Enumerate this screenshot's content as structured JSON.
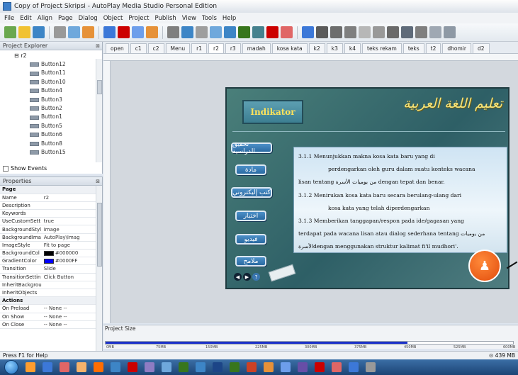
{
  "window": {
    "title": "Copy of Project Skripsi - AutoPlay Media Studio Personal Edition"
  },
  "menu": [
    "File",
    "Edit",
    "Align",
    "Page",
    "Dialog",
    "Object",
    "Project",
    "Publish",
    "View",
    "Tools",
    "Help"
  ],
  "toolbar": {
    "icons": [
      "wand-icon",
      "open-folder-icon",
      "save-icon",
      "cut-icon",
      "copy-icon",
      "paste-icon",
      "image-icon",
      "flash-icon",
      "video-icon",
      "web-icon",
      "button-icon",
      "label-icon",
      "paragraph-icon",
      "xbutton-icon",
      "slideshow-icon",
      "globe-icon",
      "plugin-icon",
      "audio-icon",
      "pdf-icon",
      "hotspot-icon",
      "input-icon",
      "checkbox-icon",
      "radio-icon",
      "combobox-icon",
      "listbox-icon",
      "tree-icon",
      "grid-icon",
      "progress-icon",
      "rectangle-icon",
      "line-icon"
    ],
    "colors": [
      "#6aa84f",
      "#f1c232",
      "#3d85c6",
      "#999999",
      "#6fa8dc",
      "#e69138",
      "#3c78d8",
      "#cc0000",
      "#6d9eeb",
      "#e69138",
      "#7f7f7f",
      "#3d85c6",
      "#9e9e9e",
      "#6fa8dc",
      "#3d85c6",
      "#38761d",
      "#45818e",
      "#cc0000",
      "#e06666",
      "#3c78d8",
      "#5b5b5b",
      "#6d6d6d",
      "#7f7f7f",
      "#b7b7b7",
      "#999999",
      "#6a6a6a",
      "#5f6b7a",
      "#7f7f7f",
      "#9fa8b3",
      "#8e99a5"
    ]
  },
  "explorer": {
    "title": "Project Explorer",
    "root": "r2",
    "items": [
      "Button12",
      "Button11",
      "Button10",
      "Button4",
      "Button3",
      "Button2",
      "Button1",
      "Button5",
      "Button6",
      "Button8",
      "Button15"
    ],
    "show_events_label": "Show Events"
  },
  "properties": {
    "title": "Properties",
    "section_page": "Page",
    "rows": [
      {
        "key": "Name",
        "value": "r2"
      },
      {
        "key": "Description",
        "value": ""
      },
      {
        "key": "Keywords",
        "value": ""
      },
      {
        "key": "UseCustomSett",
        "value": "true"
      },
      {
        "key": "BackgroundStyl",
        "value": "Image"
      },
      {
        "key": "BackgroundIma",
        "value": "AutoPlay\\Imag"
      },
      {
        "key": "ImageStyle",
        "value": "Fit to page"
      },
      {
        "key": "BackgroundCol",
        "value": "#000000",
        "swatch": "#000000"
      },
      {
        "key": "GradientColor",
        "value": "#0000FF",
        "swatch": "#0000FF"
      },
      {
        "key": "Transition",
        "value": "Slide"
      },
      {
        "key": "TransitionSettin",
        "value": "Click Button"
      },
      {
        "key": "InheritBackgrou",
        "value": ""
      },
      {
        "key": "InheritObjects",
        "value": ""
      }
    ],
    "section_actions": "Actions",
    "action_rows": [
      {
        "key": "On Preload",
        "value": "-- None --"
      },
      {
        "key": "On Show",
        "value": "-- None --"
      },
      {
        "key": "On Close",
        "value": "-- None --"
      }
    ]
  },
  "tabs": [
    "open",
    "c1",
    "c2",
    "Menu",
    "r1",
    "r2",
    "r3",
    "madah",
    "kosa kata",
    "k2",
    "k3",
    "k4",
    "teks rekam",
    "teks",
    "t2",
    "dhomir",
    "d2"
  ],
  "active_tab": "r2",
  "stage": {
    "title_box": "Indikator",
    "header_arabic": "تعليم اللغة العربية",
    "nav_buttons": [
      "تحقيق الدراسية",
      "مادة",
      "كتب إليكتروني",
      "اختبار",
      "فيديو",
      "ملامح"
    ],
    "content_lines": [
      "3.1.1      Menunjukkan   makna   kosa   kata   baru   yang   di",
      "perdengarkan oleh guru dalam suatu konteks        wacana",
      "lisan tentang من يوميات الأسرة dengan tepat        dan benar.",
      "3.1.2      Menirukan kosa kata baru secara berulang-ulang  dari",
      "kosa kata yang telah diperdengarkan",
      "3.1.3      Memberikan tanggapan/respon pada ide/gagasan  yang",
      "terdapat pada wacana lisan atau dialog  sederhana tentang  من يوميات",
      "الأسرةdengan          menggunakan struktur kalimat fi'il mudhori'."
    ]
  },
  "project_size": {
    "label": "Project Size",
    "ticks": [
      "0MB",
      "75MB",
      "150MB",
      "225MB",
      "300MB",
      "375MB",
      "450MB",
      "525MB",
      "600MB"
    ],
    "fill_fraction": 0.74
  },
  "status": {
    "left": "Press F1 for Help",
    "right": "439 MB"
  },
  "taskbar": {
    "icons": [
      "start-orb",
      "explorer-icon",
      "media-player-icon",
      "firefox-icon",
      "paint-icon",
      "chrome-icon",
      "opera-icon",
      "bear-icon",
      "camera-icon",
      "security-icon",
      "network-icon",
      "word-icon",
      "excel-icon",
      "powerpoint-icon",
      "app-icon",
      "autoplay-icon",
      "tool-icon",
      "app2-icon",
      "app3-icon",
      "app4-icon",
      "app5-icon",
      "window-icon"
    ],
    "colors": [
      "#ff9d2e",
      "#3c78d8",
      "#e06666",
      "#f6b26b",
      "#ff6d01",
      "#3d85c6",
      "#cc0000",
      "#8e7cc3",
      "#6fa8dc",
      "#38761d",
      "#3d85c6",
      "#1c4587",
      "#38761d",
      "#cc4125",
      "#e69138",
      "#6d9eeb",
      "#674ea7",
      "#cc0000",
      "#e06666",
      "#3c78d8",
      "#999999"
    ]
  }
}
